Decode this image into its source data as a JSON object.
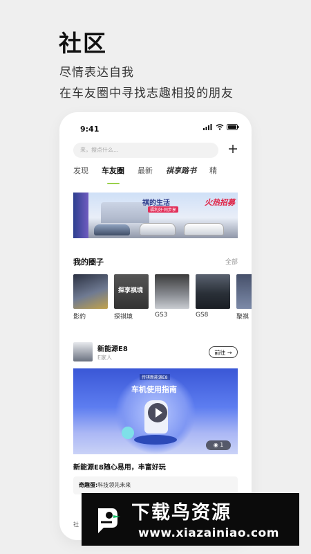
{
  "hero": {
    "title": "社区",
    "subtitle1": "尽情表达自我",
    "subtitle2": "在车友圈中寻找志趣相投的朋友"
  },
  "status_bar": {
    "time": "9:41"
  },
  "search": {
    "placeholder": "来，搜点什么..."
  },
  "tabs": [
    {
      "label": "发现",
      "active": false
    },
    {
      "label": "车友圈",
      "active": true
    },
    {
      "label": "最新",
      "active": false
    },
    {
      "label": "祺享路书",
      "active": false
    },
    {
      "label": "精",
      "active": false
    }
  ],
  "banner": {
    "slogan": "祺的生活",
    "slogan_sub": "福利好·同步享",
    "badge": "火热招募"
  },
  "my_circles": {
    "title": "我的圈子",
    "more": "全部",
    "items": [
      {
        "label": "影豹"
      },
      {
        "label": "探祺境",
        "overlay": "探享祺境"
      },
      {
        "label": "GS3"
      },
      {
        "label": "GS8"
      },
      {
        "label": "聚祺"
      }
    ]
  },
  "post": {
    "name": "新能源E8",
    "sub": "E家人",
    "goto": "前往",
    "video_top": "传祺新能源E8",
    "video_title": "车机使用指南",
    "count": "1",
    "title": "新能源E8随心易用，丰富好玩",
    "comment_user": "奇趣蛋:",
    "comment_text": "科技领先未来",
    "cut_label": "社"
  },
  "watermark": {
    "title": "下载鸟资源",
    "url": "www.xiazainiao.com"
  },
  "colors": {
    "accent": "#9ad14b",
    "watermark_bg": "#0b0b0b"
  }
}
